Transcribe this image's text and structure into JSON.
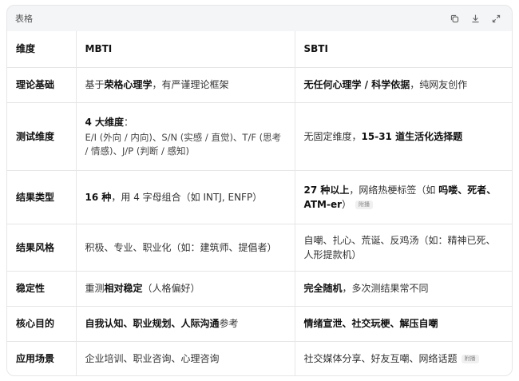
{
  "card": {
    "title": "表格",
    "tag_label": "附播"
  },
  "icons": [
    "copy-icon",
    "download-icon",
    "expand-icon"
  ],
  "header": {
    "dim": "维度",
    "mbti": "MBTI",
    "sbti": "SBTI"
  },
  "rows": {
    "r1": {
      "dim": "理论基础",
      "m1": "基于",
      "m2": "荣格心理学",
      "m3": "，有严谨理论框架",
      "s1": "无任何心理学 / 科学依据",
      "s2": "，纯网友创作"
    },
    "r2": {
      "dim": "测试维度",
      "m1": "4 大维度",
      "m2": "：",
      "m3": "E/I (外向 / 内向)、S/N (实感 / 直觉)、T/F (思考 / 情感)、J/P (判断 / 感知)",
      "s1": "无固定维度，",
      "s2": "15-31 道生活化选择题"
    },
    "r3": {
      "dim": "结果类型",
      "m1": "16 种",
      "m2": "，用 4 字母组合（如 INTJ, ENFP）",
      "s1": "27 种以上",
      "s2": "，网络热梗标签（如 ",
      "s3": "吗喽、死者、ATM-er",
      "s4": "）"
    },
    "r4": {
      "dim": "结果风格",
      "m1": "积极、专业、职业化（如：建筑师、提倡者）",
      "s1": "自嘲、扎心、荒诞、反鸡汤（如：精神已死、人形提款机）"
    },
    "r5": {
      "dim": "稳定性",
      "m1": "重测",
      "m2": "相对稳定",
      "m3": "（人格偏好）",
      "s1": "完全随机",
      "s2": "，多次测结果常不同"
    },
    "r6": {
      "dim": "核心目的",
      "m1": "自我认知、职业规划、人际沟通",
      "m2": "参考",
      "s1": "情绪宣泄、社交玩梗、解压自嘲"
    },
    "r7": {
      "dim": "应用场景",
      "m1": "企业培训、职业咨询、心理咨询",
      "s1": "社交媒体分享、好友互嘲、网络话题"
    }
  }
}
